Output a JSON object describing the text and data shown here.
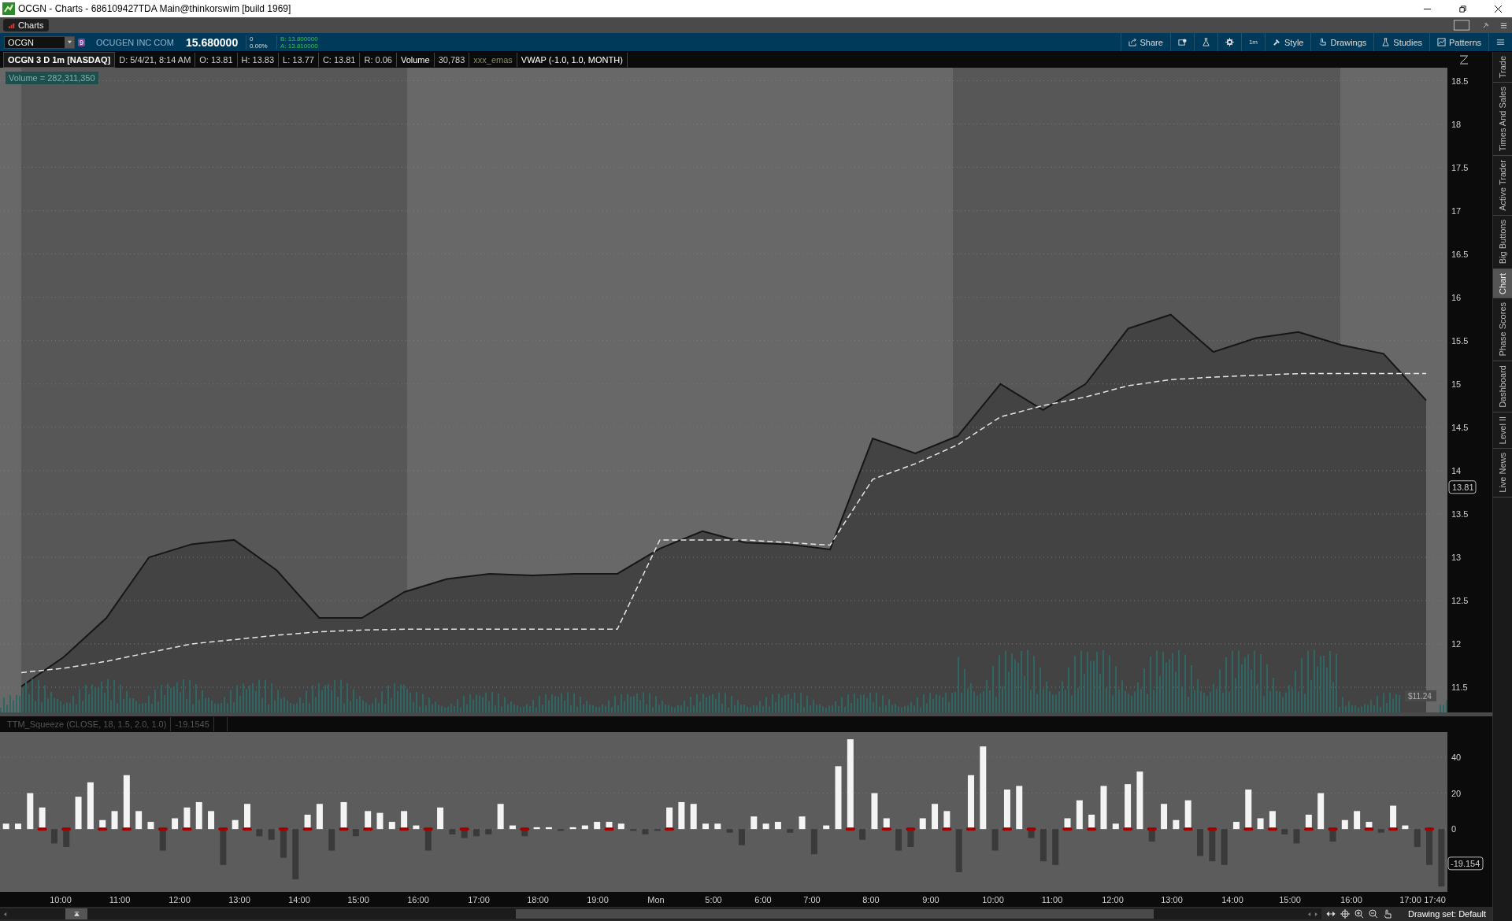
{
  "window": {
    "title": "OCGN - Charts - 686109427TDA Main@thinkorswim [build 1969]"
  },
  "tabs": [
    {
      "label": "Charts",
      "selected": true
    }
  ],
  "symbol_bar": {
    "symbol": "OCGN",
    "link_group": "9",
    "company": "OCUGEN INC COM",
    "last": "15.680000",
    "change": "0",
    "change_pct": "0.00%",
    "bid": "B: 13.800000",
    "ask": "A: 13.810000"
  },
  "toolbar": [
    {
      "label": "Share",
      "kind": "share"
    },
    {
      "kind": "alert"
    },
    {
      "kind": "flask"
    },
    {
      "kind": "gear"
    },
    {
      "label": "1m",
      "kind": "text"
    },
    {
      "label": "Style",
      "kind": "style"
    },
    {
      "label": "Drawings",
      "kind": "drawings"
    },
    {
      "label": "Studies",
      "kind": "studies"
    },
    {
      "label": "Patterns",
      "kind": "patterns"
    },
    {
      "kind": "menu"
    }
  ],
  "info_bar": [
    {
      "text": "OCGN 3 D 1m [NASDAQ]",
      "kind": "title"
    },
    {
      "text": "D: 5/4/21, 8:14 AM",
      "kind": "value"
    },
    {
      "text": "O: 13.81",
      "kind": "value"
    },
    {
      "text": "H: 13.83",
      "kind": "value"
    },
    {
      "text": "L: 13.77",
      "kind": "value"
    },
    {
      "text": "C: 13.81",
      "kind": "value"
    },
    {
      "text": "R: 0.06",
      "kind": "value"
    },
    {
      "text": "Volume",
      "kind": "study"
    },
    {
      "text": "30,783",
      "kind": "value"
    },
    {
      "text": "xxx_emas",
      "kind": "muted"
    },
    {
      "text": "VWAP (-1.0, 1.0, MONTH)",
      "kind": "study"
    }
  ],
  "price_chart": {
    "volume_label": "Volume = 282,311,350",
    "last_price_label": "13.81",
    "low_label": "$11.24",
    "chart_data": {
      "type": "line",
      "grid": true,
      "ylim": [
        11.21,
        18.65
      ],
      "yticks": [
        11.5,
        12,
        12.5,
        13,
        13.5,
        14,
        14.5,
        15,
        15.5,
        16,
        16.5,
        17,
        17.5,
        18,
        18.5
      ],
      "categories": [
        null,
        null,
        null,
        null,
        null,
        null,
        null,
        null,
        null,
        null,
        null,
        null,
        null,
        null,
        null,
        null,
        null,
        null,
        null,
        null,
        null,
        null,
        null,
        null,
        null,
        null,
        null,
        null,
        null,
        null,
        null,
        null,
        null,
        null
      ],
      "series": [
        {
          "color": "#161616",
          "values": [
            11.51,
            11.85,
            12.3,
            13.0,
            13.15,
            13.2,
            12.85,
            12.3,
            12.3,
            12.6,
            12.75,
            12.81,
            12.79,
            12.81,
            12.81,
            13.1,
            13.3,
            13.17,
            13.15,
            13.09,
            14.37,
            14.2,
            14.4,
            15.0,
            14.7,
            15.0,
            15.64,
            15.8,
            15.37,
            15.53,
            15.6,
            15.45,
            15.35,
            14.81
          ]
        },
        {
          "color": "#e6e6e6",
          "line_style": "dashed",
          "values": [
            11.67,
            11.72,
            11.8,
            11.9,
            12.0,
            12.05,
            12.1,
            12.14,
            12.16,
            12.17,
            12.17,
            12.17,
            12.17,
            12.17,
            12.17,
            13.2,
            13.2,
            13.2,
            13.17,
            13.14,
            13.9,
            14.08,
            14.3,
            14.62,
            14.75,
            14.85,
            14.98,
            15.05,
            15.08,
            15.1,
            15.12,
            15.12,
            15.12,
            15.12
          ]
        }
      ]
    }
  },
  "study": {
    "title": "TTM_Squeeze (CLOSE, 18, 1.5, 2.0, 1.0)",
    "value": "-19.1545",
    "last_value_label": "-19.154",
    "chart_data": {
      "type": "bar",
      "stacked": true,
      "grid": true,
      "ylim": [
        -35,
        54
      ],
      "yticks": [
        0,
        20,
        40
      ],
      "categories": [
        null,
        null,
        null,
        null,
        null,
        null,
        null,
        null,
        null,
        null,
        null,
        null,
        null,
        null,
        null,
        null,
        null,
        null,
        null,
        null,
        null,
        null,
        null,
        null,
        null,
        null,
        null,
        null,
        null,
        null,
        null,
        null,
        null,
        null,
        null,
        null,
        null,
        null,
        null,
        null,
        null,
        null,
        null,
        null,
        null,
        null,
        null,
        null,
        null,
        null,
        null,
        null,
        null,
        null,
        null,
        null,
        null,
        null,
        null,
        null,
        null,
        null,
        null,
        null,
        null,
        null,
        null,
        null,
        null,
        null,
        null,
        null,
        null,
        null,
        null,
        null,
        null,
        null,
        null,
        null,
        null,
        null,
        null,
        null,
        null,
        null,
        null,
        null,
        null,
        null,
        null,
        null,
        null,
        null,
        null,
        null,
        null,
        null,
        null,
        null,
        null,
        null,
        null,
        null,
        null,
        null,
        null,
        null,
        null,
        null,
        null,
        null,
        null,
        null,
        null,
        null,
        null,
        null,
        null,
        null
      ],
      "series": [
        {
          "color": "#f4f4f4",
          "values": [
            3,
            3,
            20,
            12,
            null,
            null,
            18,
            26,
            5,
            10,
            30,
            10,
            4,
            null,
            6,
            12,
            15,
            10,
            null,
            5,
            14,
            null,
            null,
            null,
            null,
            8,
            14,
            null,
            15,
            null,
            10,
            9,
            4,
            10,
            2,
            null,
            12,
            null,
            null,
            null,
            null,
            14,
            2,
            null,
            1,
            1,
            null,
            1,
            2,
            4,
            4,
            3,
            null,
            null,
            null,
            12,
            15,
            14,
            3,
            3,
            null,
            null,
            7,
            3,
            4,
            null,
            7,
            null,
            2,
            35,
            50,
            null,
            20,
            6,
            null,
            null,
            6,
            14,
            10,
            null,
            30,
            46,
            null,
            22,
            24,
            null,
            null,
            null,
            6,
            16,
            8,
            24,
            3,
            25,
            32,
            null,
            14,
            5,
            16,
            null,
            null,
            null,
            4,
            22,
            6,
            10,
            null,
            null,
            8,
            20,
            null,
            5,
            10,
            4,
            null,
            13,
            2,
            null,
            null,
            null
          ]
        },
        {
          "color": "#3a3a3a",
          "values": [
            null,
            null,
            null,
            null,
            -8,
            -10,
            null,
            null,
            null,
            null,
            null,
            null,
            null,
            -12,
            null,
            null,
            null,
            null,
            -20,
            null,
            null,
            -4,
            -6,
            -16,
            -28,
            null,
            null,
            -12,
            null,
            -4,
            null,
            null,
            null,
            null,
            null,
            -12,
            null,
            -3,
            -5,
            -4,
            -3,
            null,
            null,
            -4,
            null,
            null,
            -1,
            null,
            null,
            null,
            null,
            null,
            -1,
            -3,
            -1,
            null,
            null,
            null,
            null,
            null,
            -2,
            -9,
            null,
            null,
            null,
            -2,
            null,
            -14,
            null,
            null,
            null,
            -6,
            null,
            null,
            -12,
            -10,
            null,
            null,
            null,
            -24,
            null,
            null,
            -12,
            null,
            null,
            -5,
            -18,
            -20,
            null,
            null,
            null,
            null,
            null,
            null,
            null,
            -7,
            null,
            null,
            null,
            -15,
            -18,
            -20,
            null,
            null,
            null,
            null,
            -3,
            -8,
            null,
            null,
            -7,
            null,
            null,
            null,
            -2,
            null,
            null,
            -10,
            -20,
            -32
          ]
        }
      ]
    }
  },
  "time_labels": [
    "10:00",
    "11:00",
    "12:00",
    "13:00",
    "14:00",
    "15:00",
    "16:00",
    "17:00",
    "18:00",
    "19:00",
    "Mon",
    "5:00",
    "6:00",
    "7:00",
    "8:00",
    "9:00",
    "10:00",
    "11:00",
    "12:00",
    "13:00",
    "14:00",
    "15:00",
    "16:00",
    "17:00",
    "17:40"
  ],
  "side_tabs": [
    {
      "label": "Trade",
      "selected": false
    },
    {
      "label": "Times And Sales",
      "selected": false
    },
    {
      "label": "Active Trader",
      "selected": false
    },
    {
      "label": "Big Buttons",
      "selected": false
    },
    {
      "label": "Chart",
      "selected": true
    },
    {
      "label": "Phase Scores",
      "selected": false
    },
    {
      "label": "Dashboard",
      "selected": false
    },
    {
      "label": "Level II",
      "selected": false
    },
    {
      "label": "Live News",
      "selected": false
    }
  ],
  "status": {
    "drawing_set": "Drawing set: Default"
  }
}
